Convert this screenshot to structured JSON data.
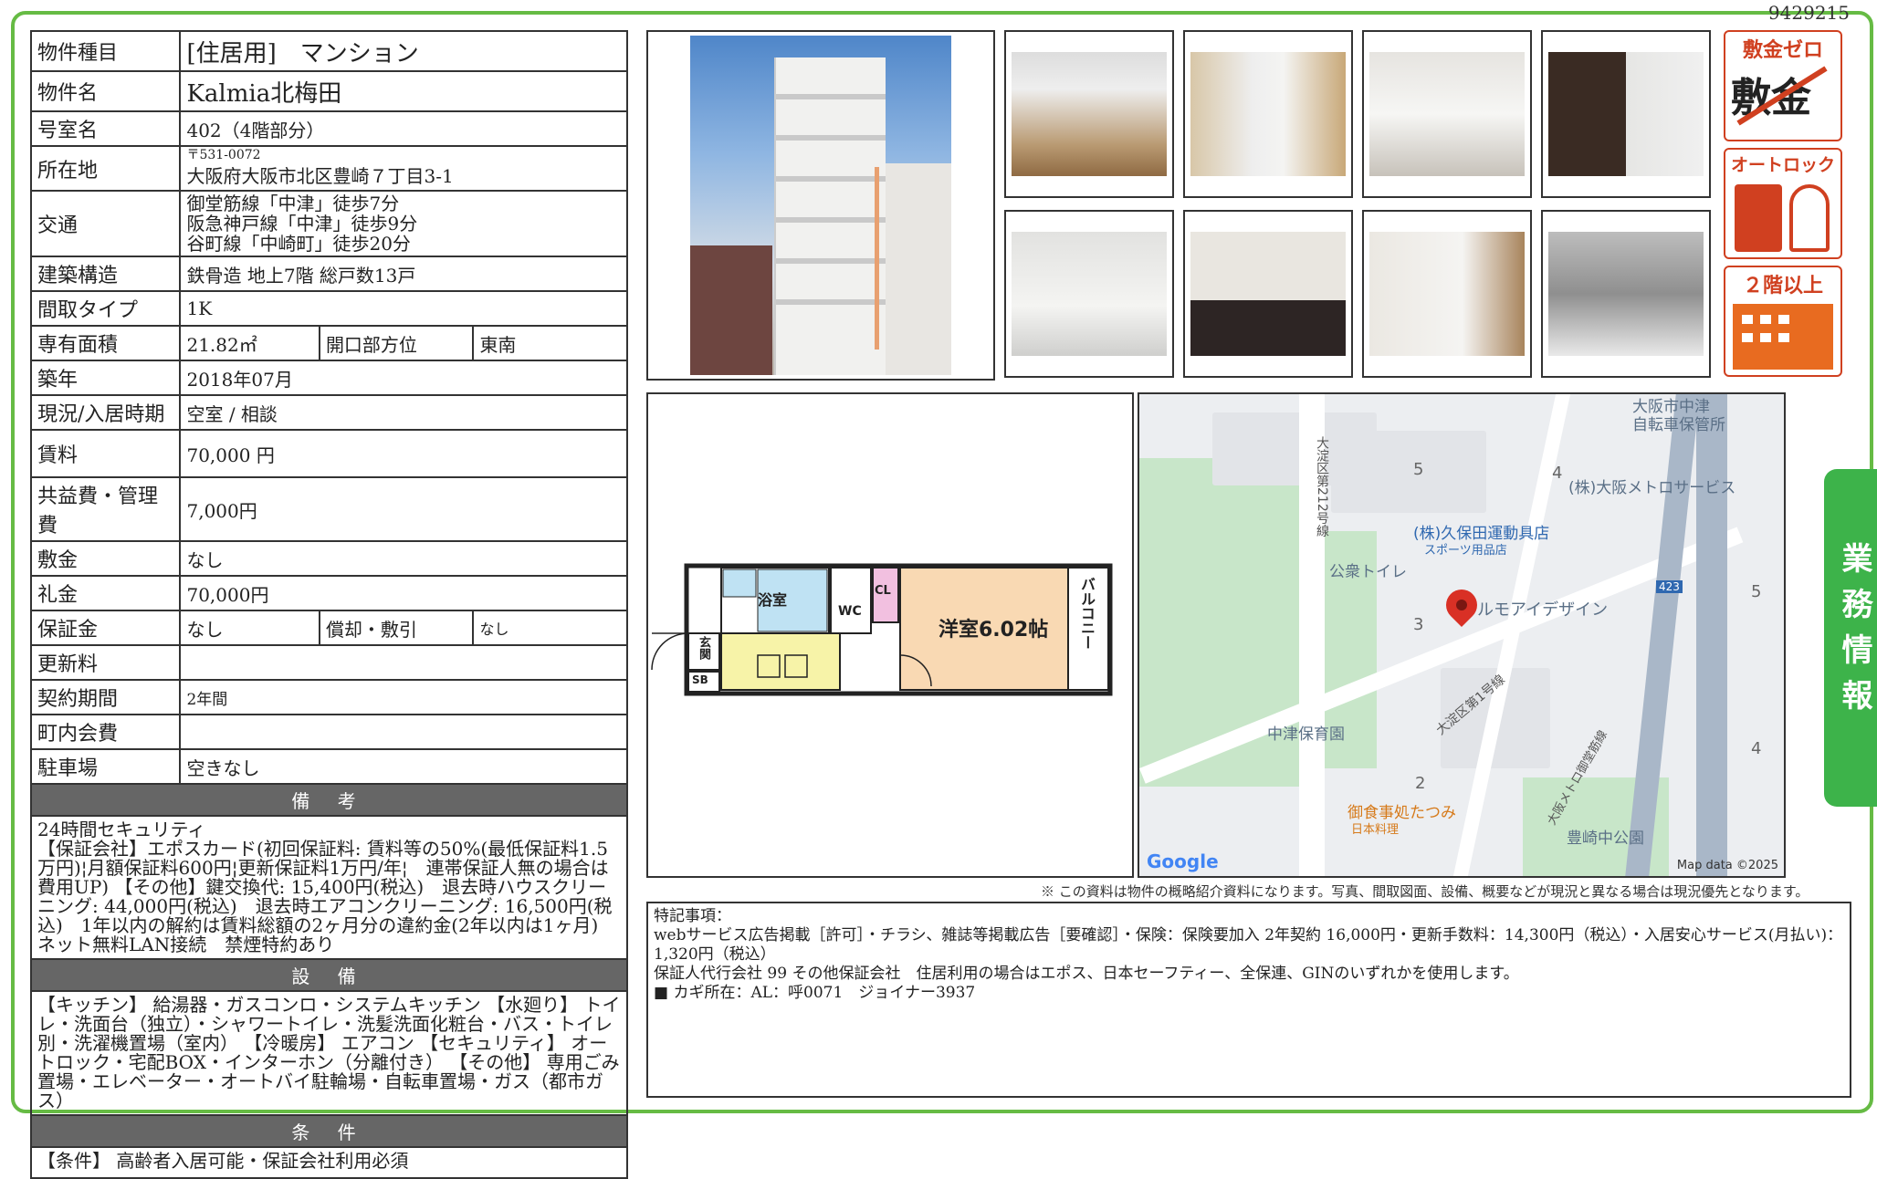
{
  "doc_id": "9429215",
  "property": {
    "type_label": "物件種目",
    "type_value": "[住居用]　マンション",
    "name_label": "物件名",
    "name_value": "Kalmia北梅田",
    "room_label": "号室名",
    "room_value": "402（4階部分）",
    "address_label": "所在地",
    "address_postal": "〒531-0072",
    "address_value": "大阪府大阪市北区豊崎７丁目3-1",
    "transit_label": "交通",
    "transit_lines": [
      "御堂筋線「中津」徒歩7分",
      "阪急神戸線「中津」徒歩9分",
      "谷町線「中崎町」徒歩20分"
    ],
    "structure_label": "建築構造",
    "structure_value": "鉄骨造 地上7階 総戸数13戸",
    "layout_label": "間取タイプ",
    "layout_value": "1K",
    "area_label": "専有面積",
    "area_value": "21.82㎡",
    "direction_label": "開口部方位",
    "direction_value": "東南",
    "built_label": "築年",
    "built_value": "2018年07月",
    "status_label": "現況/入居時期",
    "status_value": "空室 / 相談",
    "rent_label": "賃料",
    "rent_value": "70,000 円",
    "common_fee_label": "共益費・管理費",
    "common_fee_value": "7,000円",
    "deposit_label": "敷金",
    "deposit_value": "なし",
    "key_money_label": "礼金",
    "key_money_value": "70,000円",
    "guarantee_label": "保証金",
    "guarantee_value": "なし",
    "amort_label": "償却・敷引",
    "amort_value": "なし",
    "renewal_label": "更新料",
    "renewal_value": "",
    "contract_label": "契約期間",
    "contract_value": "2年間",
    "community_label": "町内会費",
    "community_value": "",
    "parking_label": "駐車場",
    "parking_value": "空きなし"
  },
  "notes": {
    "header": "備 考",
    "text": "24時間セキュリティ\n【保証会社】エポスカード(初回保証料: 賃料等の50%(最低保証料1.5万円)¦月額保証料600円¦更新保証料1万円/年¦　連帯保証人無の場合は費用UP) 【その他】鍵交換代: 15,400円(税込)　退去時ハウスクリーニング: 44,000円(税込)　退去時エアコンクリーニング: 16,500円(税込)　1年以内の解約は賃料総額の2ヶ月分の違約金(2年以内は1ヶ月)　ネット無料LAN接続　禁煙特約あり"
  },
  "equipment": {
    "header": "設 備",
    "text": "【キッチン】 給湯器・ガスコンロ・システムキッチン 【水廻り】 トイレ・洗面台（独立）・シャワートイレ・洗髪洗面化粧台・バス・トイレ別・洗濯機置場（室内） 【冷暖房】 エアコン 【セキュリティ】 オートロック・宅配BOX・インターホン（分離付き） 【その他】 専用ごみ置場・エレベーター・オートバイ駐輪場・自転車置場・ガス（都市ガス）"
  },
  "conditions": {
    "header": "条 件",
    "text": "【条件】 高齢者入居可能・保証会社利用必須"
  },
  "badges": {
    "zero_deposit": "敷金ゼロ",
    "zero_deposit_strike": "敷金",
    "autolock": "オートロック",
    "floor2": "２階以上"
  },
  "floorplan": {
    "bath": "浴室",
    "wc": "WC",
    "closet": "CL",
    "western_room": "洋室6.02帖",
    "balcony": "バルコニー",
    "entrance": "玄関",
    "shoebox": "SB"
  },
  "map": {
    "labels": {
      "bike_parking": "大阪市中津\n自転車保管所",
      "metro_service": "(株)大阪メトロサービス",
      "kubota": "(株)久保田運動具店",
      "kubota_sub": "スポーツ用品店",
      "toilet": "公衆トイレ",
      "rumoi": "ルモアイデザイン",
      "nursery": "中津保育園",
      "restaurant": "御食事処たつみ",
      "restaurant_sub": "日本料理",
      "park": "豊崎中公園",
      "road1": "大淀区第212号線",
      "road2": "大淀区第1号線",
      "road3": "大阪メトロ御堂筋線",
      "route_num": "423",
      "n5a": "5",
      "n4a": "4",
      "n3": "3",
      "n2": "2",
      "n5b": "5",
      "n4b": "4"
    },
    "google": "Google",
    "mapdata": "Map data ©2025"
  },
  "side_tab": "業務情報",
  "disclaimer": "※ この資料は物件の概略紹介資料になります。写真、間取図面、設備、概要などが現況と異なる場合は現況優先となります。",
  "remarks": {
    "line1": "特記事項：",
    "line2": "webサービス広告掲載［許可］・チラシ、雑誌等掲載広告［要確認］・保険：保険要加入 2年契約 16,000円・更新手数料：14,300円（税込）・入居安心サービス(月払い)：1,320円（税込）",
    "line3": "保証人代行会社 99 その他保証会社　住居利用の場合はエポス、日本セーフティー、全保連、GINのいずれかを使用します。",
    "line4": "■ カギ所在：AL：呼0071　ジョイナー3937"
  }
}
